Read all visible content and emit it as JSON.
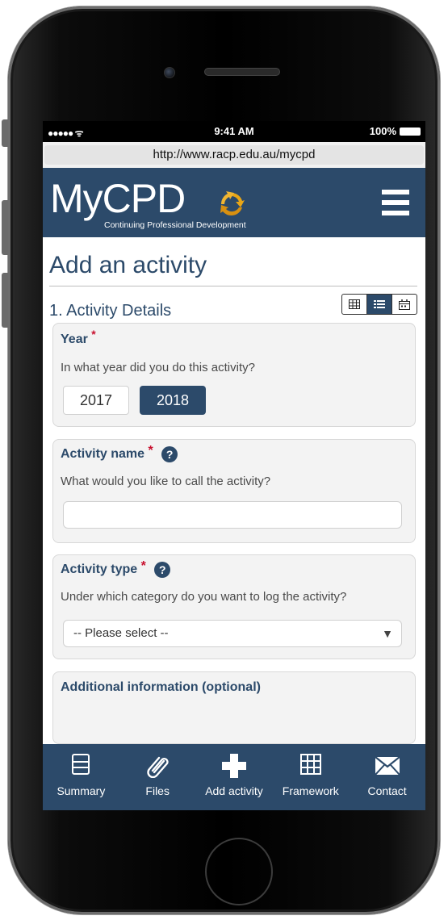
{
  "status_bar": {
    "signal": "●●●●● ᯤ",
    "time": "9:41 AM",
    "battery": "100%"
  },
  "browser": {
    "url": "http://www.racp.edu.au/mycpd"
  },
  "header": {
    "logo_text": "MyCPD",
    "logo_subtitle": "Continuing Professional Development",
    "menu_icon": "hamburger-icon"
  },
  "page": {
    "title": "Add an activity",
    "section_title": "1. Activity Details",
    "view_toggle": [
      {
        "icon": "table-view-icon",
        "active": false
      },
      {
        "icon": "list-view-icon",
        "active": true
      },
      {
        "icon": "calendar-view-icon",
        "active": false
      }
    ]
  },
  "form": {
    "year": {
      "label": "Year",
      "required_mark": "*",
      "question": "In what year did you do this activity?",
      "options": [
        "2017",
        "2018"
      ],
      "selected": "2018"
    },
    "activity_name": {
      "label": "Activity name",
      "required_mark": "*",
      "help": "?",
      "question": "What would you like to call the activity?",
      "value": ""
    },
    "activity_type": {
      "label": "Activity type",
      "required_mark": "*",
      "help": "?",
      "question": "Under which category do you want to log the activity?",
      "selected": "-- Please select --",
      "caret": "▼"
    },
    "additional": {
      "label": "Additional information (optional)"
    }
  },
  "bottom_nav": [
    {
      "label": "Summary",
      "icon": "summary-icon"
    },
    {
      "label": "Files",
      "icon": "paperclip-icon"
    },
    {
      "label": "Add activity",
      "icon": "plus-icon"
    },
    {
      "label": "Framework",
      "icon": "grid-icon"
    },
    {
      "label": "Contact",
      "icon": "envelope-icon"
    }
  ],
  "colors": {
    "brand": "#2c4a6a",
    "accent": "#e8a617",
    "required": "#c8102e"
  }
}
